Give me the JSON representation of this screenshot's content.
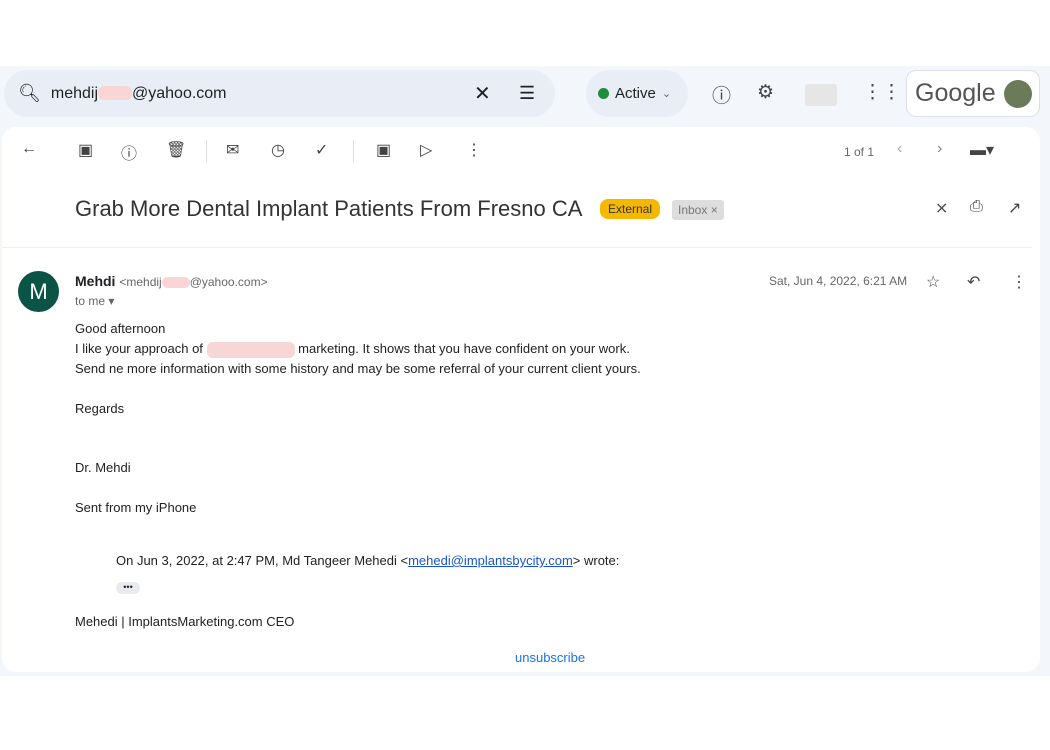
{
  "search": {
    "value_prefix": "mehdij",
    "value_suffix": "@yahoo.com",
    "icon": "search-icon",
    "clear": "✕",
    "options": "tune-icon"
  },
  "status": {
    "label": "Active",
    "chevron": "⌄",
    "color": "#1e8e3e"
  },
  "header": {
    "brand": "Google"
  },
  "toolbar": {
    "pager": "1 of 1"
  },
  "email": {
    "subject": "Grab More Dental Implant Patients From Fresno CA",
    "labels": {
      "external": "External",
      "inbox": "Inbox",
      "inbox_remove": "×"
    },
    "sender": {
      "initial": "M",
      "name": "Mehdi",
      "email_prefix": "<mehdij",
      "email_suffix": "@yahoo.com>",
      "avatar_color": "#0b5345"
    },
    "to": "to me ▾",
    "date": "Sat, Jun 4, 2022, 6:21 AM",
    "body": {
      "greeting": "Good afternoon",
      "line2_a": "I like your approach of",
      "line2_b": "marketing.  It shows that you have confident on your work.",
      "line3": "Send ne more information with some history and may be some referral of your current client yours.",
      "regards": "Regards",
      "signature": "Dr. Mehdi",
      "sent_from": "Sent from my iPhone"
    },
    "quote": {
      "prefix": "On Jun 3, 2022, at 2:47 PM, Md Tangeer Mehedi <",
      "link": "mehedi@implantsbycity.com",
      "suffix": "> wrote:",
      "expand": "•••"
    },
    "footer_sig": "Mehedi | ImplantsMarketing.com CEO",
    "unsubscribe": "unsubscribe"
  }
}
